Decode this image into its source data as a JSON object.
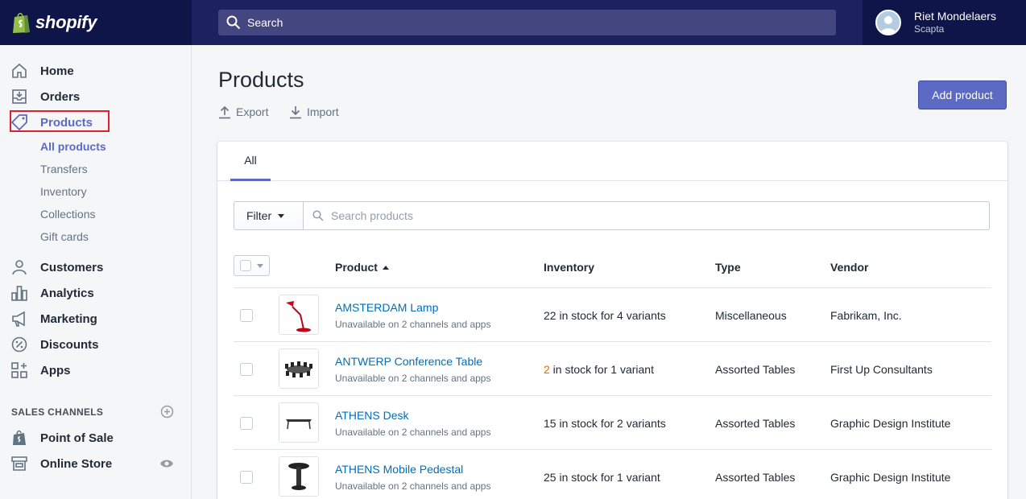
{
  "brand": {
    "name": "shopify"
  },
  "search": {
    "placeholder": "Search"
  },
  "user": {
    "name": "Riet Mondelaers",
    "store": "Scapta"
  },
  "sidebar": {
    "items": [
      {
        "label": "Home",
        "icon": "home-icon"
      },
      {
        "label": "Orders",
        "icon": "orders-icon"
      },
      {
        "label": "Products",
        "icon": "tag-icon"
      },
      {
        "label": "Customers",
        "icon": "customers-icon"
      },
      {
        "label": "Analytics",
        "icon": "analytics-icon"
      },
      {
        "label": "Marketing",
        "icon": "megaphone-icon"
      },
      {
        "label": "Discounts",
        "icon": "discount-icon"
      },
      {
        "label": "Apps",
        "icon": "apps-icon"
      }
    ],
    "subitems": [
      "All products",
      "Transfers",
      "Inventory",
      "Collections",
      "Gift cards"
    ],
    "sales_channels_title": "SALES CHANNELS",
    "channels": [
      {
        "label": "Point of Sale",
        "icon": "pos-bag-icon"
      },
      {
        "label": "Online Store",
        "icon": "store-icon"
      }
    ]
  },
  "page": {
    "title": "Products",
    "export_label": "Export",
    "import_label": "Import",
    "add_label": "Add product",
    "tab_all": "All",
    "filter_label": "Filter",
    "search_products_placeholder": "Search products"
  },
  "table": {
    "columns": [
      "Product",
      "Inventory",
      "Type",
      "Vendor"
    ],
    "rows": [
      {
        "name": "AMSTERDAM Lamp",
        "sub": "Unavailable on 2 channels and apps",
        "inv_count": "22",
        "inv_rest": " in stock for 4 variants",
        "low": false,
        "type": "Miscellaneous",
        "vendor": "Fabrikam, Inc."
      },
      {
        "name": "ANTWERP Conference Table",
        "sub": "Unavailable on 2 channels and apps",
        "inv_count": "2",
        "inv_rest": " in stock for 1 variant",
        "low": true,
        "type": "Assorted Tables",
        "vendor": "First Up Consultants"
      },
      {
        "name": "ATHENS Desk",
        "sub": "Unavailable on 2 channels and apps",
        "inv_count": "15",
        "inv_rest": " in stock for 2 variants",
        "low": false,
        "type": "Assorted Tables",
        "vendor": "Graphic Design Institute"
      },
      {
        "name": "ATHENS Mobile Pedestal",
        "sub": "Unavailable on 2 channels and apps",
        "inv_count": "25",
        "inv_rest": " in stock for 1 variant",
        "low": false,
        "type": "Assorted Tables",
        "vendor": "Graphic Design Institute"
      }
    ]
  },
  "colors": {
    "accent": "#5c6ac4",
    "topbar": "#1c2260",
    "link": "#006fbb",
    "low_stock": "#ed6a00",
    "highlight": "#e0202a"
  }
}
